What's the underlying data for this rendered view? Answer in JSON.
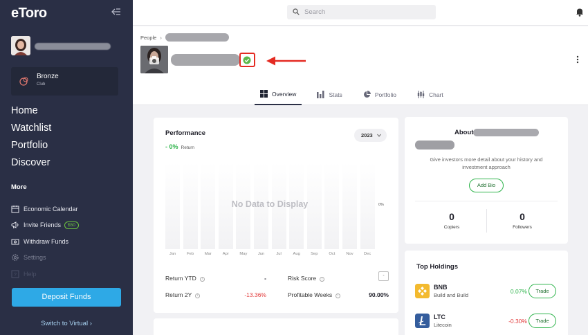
{
  "sidebar": {
    "logo": "eToro",
    "club": {
      "name": "Bronze",
      "sub": "Club"
    },
    "main_nav": [
      "Home",
      "Watchlist",
      "Portfolio",
      "Discover"
    ],
    "more_label": "More",
    "more_nav": [
      {
        "label": "Economic Calendar",
        "icon": "calendar-icon"
      },
      {
        "label": "Invite Friends",
        "icon": "megaphone-icon",
        "badge": "$50"
      },
      {
        "label": "Withdraw Funds",
        "icon": "withdraw-icon"
      },
      {
        "label": "Settings",
        "icon": "gear-icon"
      },
      {
        "label": "Help",
        "icon": "help-icon"
      }
    ],
    "deposit_label": "Deposit Funds",
    "switch_label": "Switch to Virtual ›"
  },
  "topbar": {
    "search_placeholder": "Search"
  },
  "profile": {
    "breadcrumb_root": "People",
    "tabs": [
      {
        "label": "Overview",
        "icon": "overview-icon",
        "active": true
      },
      {
        "label": "Stats",
        "icon": "stats-icon"
      },
      {
        "label": "Portfolio",
        "icon": "portfolio-pie-icon"
      },
      {
        "label": "Chart",
        "icon": "chart-icon"
      }
    ]
  },
  "performance": {
    "title": "Performance",
    "return_value": "- 0%",
    "return_label": "Return",
    "year": "2023",
    "no_data": "No Data to Display",
    "axis_value": "0%",
    "months": [
      "Jan",
      "Feb",
      "Mar",
      "Apr",
      "May",
      "Jun",
      "Jul",
      "Aug",
      "Sep",
      "Oct",
      "Nov",
      "Dec"
    ],
    "stats": {
      "return_ytd_label": "Return YTD",
      "return_ytd_value": "-",
      "return_2y_label": "Return 2Y",
      "return_2y_value": "-13.36%",
      "risk_label": "Risk Score",
      "risk_value": "-",
      "profitable_label": "Profitable Weeks",
      "profitable_value": "90.00%"
    }
  },
  "about": {
    "title": "About",
    "description": "Give investors more detail about your history and investment approach",
    "add_bio": "Add Bio",
    "copiers_value": "0",
    "copiers_label": "Copiers",
    "followers_value": "0",
    "followers_label": "Followers"
  },
  "holdings": {
    "title": "Top Holdings",
    "items": [
      {
        "symbol": "BNB",
        "name": "Build and Build",
        "change": "0.07%",
        "trend": "pos",
        "trade": "Trade",
        "color": "#f3ba2f"
      },
      {
        "symbol": "LTC",
        "name": "Litecoin",
        "change": "-0.30%",
        "trend": "neg",
        "trade": "Trade",
        "color": "#345d9d"
      }
    ]
  }
}
